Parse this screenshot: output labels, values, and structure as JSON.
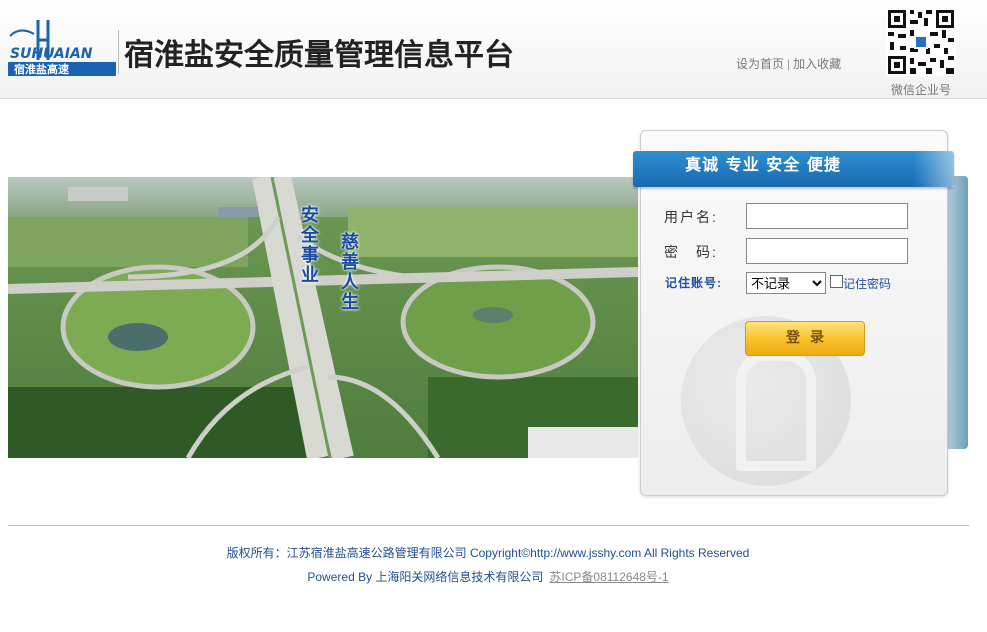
{
  "header": {
    "logo_text": "SUHUAIAN",
    "logo_subtext": "宿淮盐高速",
    "title": "宿淮盐安全质量管理信息平台",
    "links": {
      "set_home": "设为首页",
      "separator": "|",
      "add_favorite": "加入收藏"
    },
    "qr_caption": "微信企业号"
  },
  "banner": {
    "slogan_1": "安全事业",
    "slogan_2": "慈善人生"
  },
  "login": {
    "ribbon_text": "真诚 专业 安全 便捷",
    "username_label": "用户名:",
    "username_value": "",
    "password_label": "密　码:",
    "password_value": "",
    "remember_label": "记住账号:",
    "remember_options": [
      "不记录"
    ],
    "remember_selected": "不记录",
    "remember_password_label": "记住密码",
    "remember_password_checked": false,
    "login_button": "登录"
  },
  "footer": {
    "copyright": "版权所有：江苏宿淮盐高速公路管理有限公司 Copyright©http://www.jsshy.com All Rights Reserved",
    "powered_by": "Powered By 上海阳关网络信息技术有限公司",
    "icp": "苏ICP备08112648号-1"
  },
  "colors": {
    "brand_blue": "#1669b2",
    "ribbon_top": "#2f8fd0",
    "footer_text": "#1f4f8f",
    "button_gold": "#f8c02a",
    "slogan_blue": "#1a4ba0"
  }
}
